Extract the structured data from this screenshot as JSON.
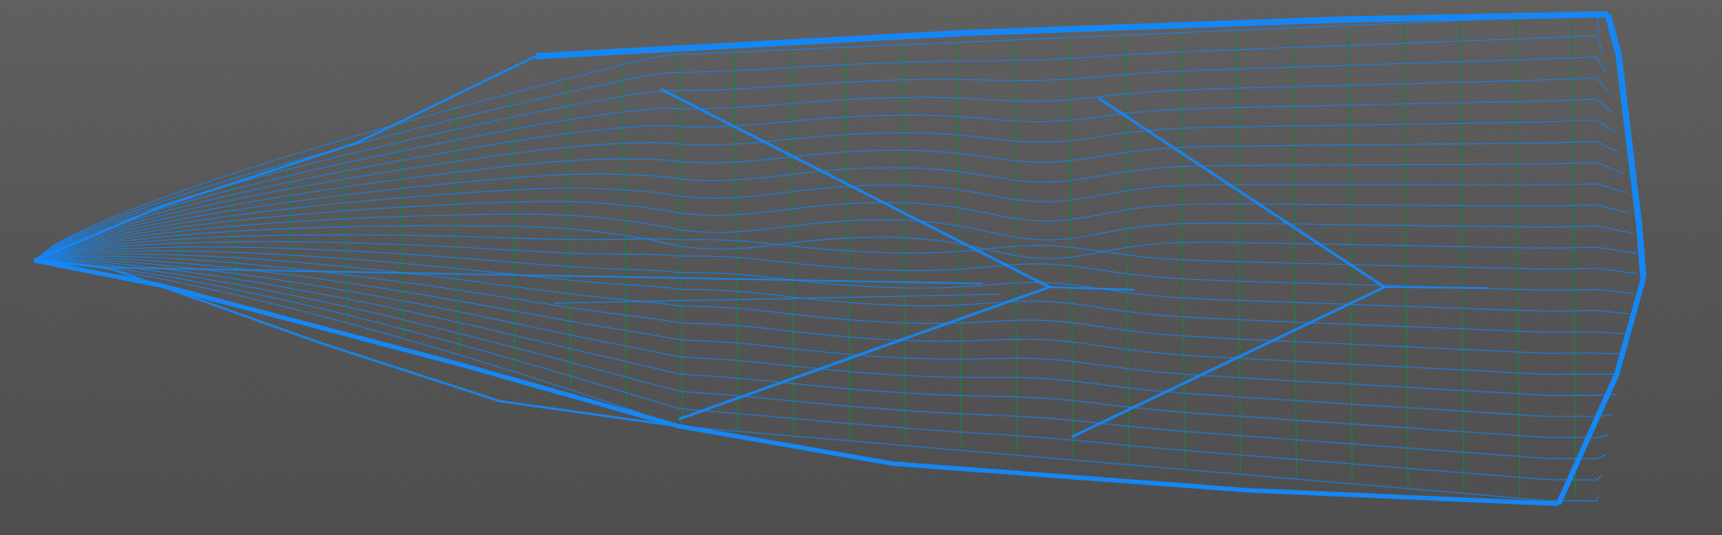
{
  "viewport": {
    "view_mode": "wireframe",
    "object": "hull-mesh",
    "background": [
      "#5f5f5f",
      "#4d4d4d"
    ]
  },
  "mesh": {
    "waterline_count": 24,
    "station_count": 27,
    "waterline_color": "#1a7fe6",
    "station_color": "#1e7f3c",
    "edge_color": "#1587f5"
  }
}
